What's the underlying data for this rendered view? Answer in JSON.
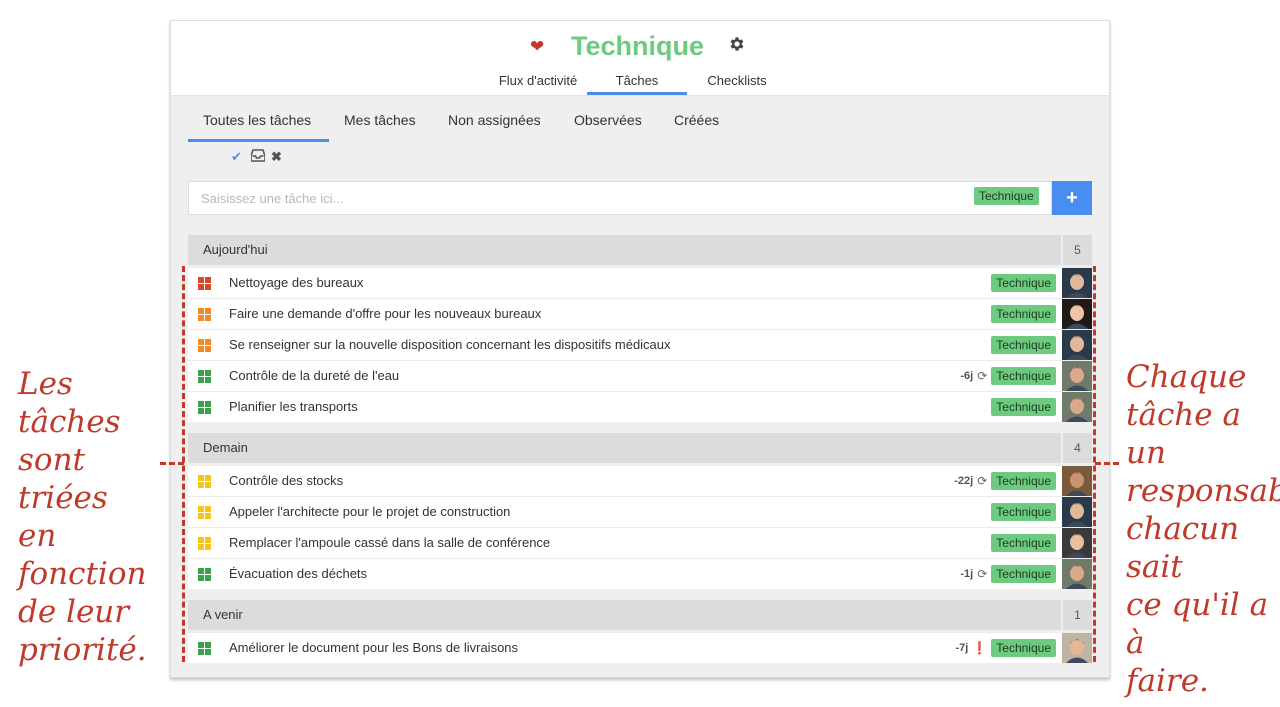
{
  "header": {
    "title": "Technique",
    "heart_icon": "heart-icon",
    "gear_icon": "gear-icon",
    "title_color": "#6ccb7f"
  },
  "main_tabs": [
    {
      "label": "Flux d'activité"
    },
    {
      "label": "Tâches"
    },
    {
      "label": "Checklists"
    }
  ],
  "subtabs": [
    {
      "label": "Toutes les tâches"
    },
    {
      "label": "Mes tâches"
    },
    {
      "label": "Non assignées"
    },
    {
      "label": "Observées"
    },
    {
      "label": "Créées"
    }
  ],
  "mini_actions": [
    "check-icon",
    "inbox-icon",
    "close-icon"
  ],
  "input": {
    "placeholder": "Saisissez une tâche ici...",
    "tag": "Technique",
    "add_label": "+"
  },
  "colors": {
    "accent": "#4a8df0",
    "tag": "#6ccb7f",
    "prio_red": "#d9472b",
    "prio_orange": "#f08a24",
    "prio_yellow": "#f5c518",
    "prio_green": "#3aa34a",
    "annotation": "#c0392b"
  },
  "groups": [
    {
      "title": "Aujourd'hui",
      "count": "5",
      "tasks": [
        {
          "text": "Nettoyage des bureaux",
          "priority": "red",
          "tag": "Technique",
          "overdue": "",
          "icon": ""
        },
        {
          "text": "Faire une demande d'offre pour les nouveaux bureaux",
          "priority": "orange",
          "tag": "Technique",
          "overdue": "",
          "icon": ""
        },
        {
          "text": "Se renseigner sur la nouvelle disposition concernant les dispositifs médicaux",
          "priority": "orange",
          "tag": "Technique",
          "overdue": "",
          "icon": ""
        },
        {
          "text": "Contrôle de la dureté de l'eau",
          "priority": "green",
          "tag": "Technique",
          "overdue": "-6j",
          "icon": "repeat-icon"
        },
        {
          "text": "Planifier les transports",
          "priority": "green",
          "tag": "Technique",
          "overdue": "",
          "icon": ""
        }
      ]
    },
    {
      "title": "Demain",
      "count": "4",
      "tasks": [
        {
          "text": "Contrôle des stocks",
          "priority": "yellow",
          "tag": "Technique",
          "overdue": "-22j",
          "icon": "repeat-icon"
        },
        {
          "text": "Appeler l'architecte pour le projet de construction",
          "priority": "yellow",
          "tag": "Technique",
          "overdue": "",
          "icon": ""
        },
        {
          "text": "Remplacer l'ampoule cassé dans la salle de conférence",
          "priority": "yellow",
          "tag": "Technique",
          "overdue": "",
          "icon": ""
        },
        {
          "text": "Évacuation des déchets",
          "priority": "green",
          "tag": "Technique",
          "overdue": "-1j",
          "icon": "repeat-icon"
        }
      ]
    },
    {
      "title": "A venir",
      "count": "1",
      "tasks": [
        {
          "text": "Améliorer le document pour les Bons de livraisons",
          "priority": "green",
          "tag": "Technique",
          "overdue": "-7j",
          "icon": "info-icon"
        }
      ]
    }
  ],
  "annotations": {
    "left": [
      "Les tâches",
      "sont triées",
      "en fonction",
      "de leur",
      "priorité."
    ],
    "right": [
      "Chaque",
      "tâche a un",
      "responsable,",
      "chacun sait",
      "ce qu'il a à",
      "faire."
    ]
  }
}
